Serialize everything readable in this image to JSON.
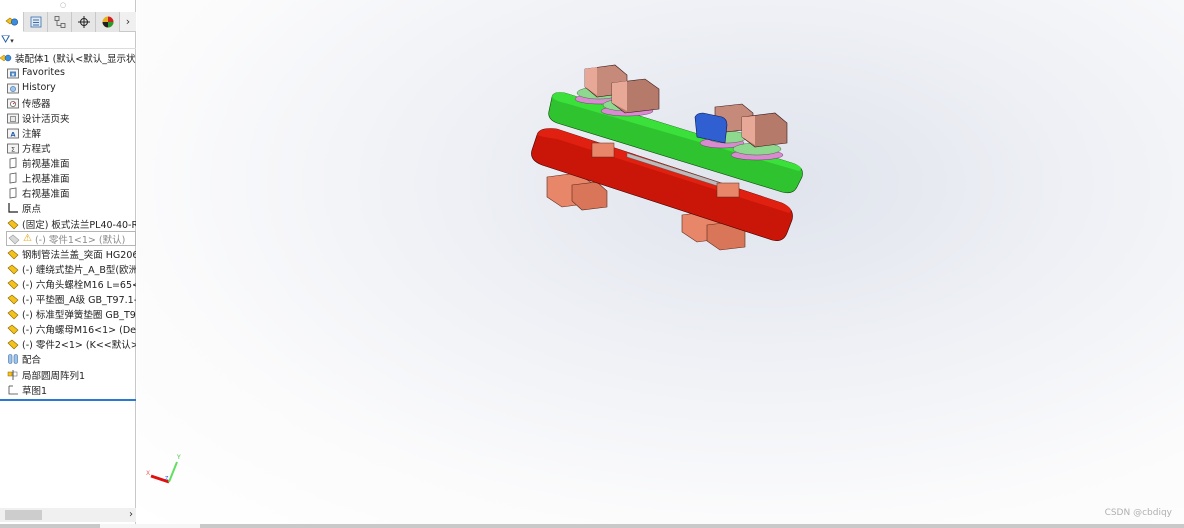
{
  "panel": {
    "tabs": [
      {
        "icon": "feature-manager-icon",
        "active": true
      },
      {
        "icon": "property-manager-icon",
        "active": false
      },
      {
        "icon": "configuration-manager-icon",
        "active": false
      },
      {
        "icon": "dimxpert-manager-icon",
        "active": false
      },
      {
        "icon": "display-manager-icon",
        "active": false
      }
    ],
    "tabs_more": "›",
    "filter": "▾",
    "tree": {
      "root": "装配体1  (默认<默认_显示状态",
      "items": [
        {
          "label": "Favorites",
          "icon": "favorites-folder-icon"
        },
        {
          "label": "History",
          "icon": "history-folder-icon"
        },
        {
          "label": "传感器",
          "icon": "sensors-folder-icon"
        },
        {
          "label": "设计活页夹",
          "icon": "design-binder-icon"
        },
        {
          "label": "注解",
          "icon": "annotations-icon"
        },
        {
          "label": "方程式",
          "icon": "equations-icon"
        },
        {
          "label": "前视基准面",
          "icon": "plane-icon"
        },
        {
          "label": "上视基准面",
          "icon": "plane-icon"
        },
        {
          "label": "右视基准面",
          "icon": "plane-icon"
        },
        {
          "label": "原点",
          "icon": "origin-icon"
        },
        {
          "label": "(固定) 板式法兰PL40-40-R",
          "icon": "part-icon"
        },
        {
          "label": "(-) 零件1<1> (默认)",
          "icon": "part-suppressed-icon",
          "suppressed": true,
          "warning": "⚠"
        },
        {
          "label": "钢制管法兰盖_突面 HG206",
          "icon": "part-icon"
        },
        {
          "label": "(-) 缠绕式垫片_A_B型(欧洲",
          "icon": "part-icon"
        },
        {
          "label": "(-) 六角头螺栓M16 L=65<",
          "icon": "part-icon"
        },
        {
          "label": "(-) 平垫圈_A级 GB_T97.1-",
          "icon": "part-icon"
        },
        {
          "label": "(-) 标准型弹簧垫圈 GB_T9",
          "icon": "part-icon"
        },
        {
          "label": "(-) 六角螺母M16<1> (Def",
          "icon": "part-icon"
        },
        {
          "label": "(-) 零件2<1> (K<<默认>_",
          "icon": "part-icon"
        },
        {
          "label": "配合",
          "icon": "mates-icon"
        },
        {
          "label": "局部圆周阵列1",
          "icon": "circular-pattern-icon"
        },
        {
          "label": "草图1",
          "icon": "sketch-icon"
        }
      ]
    },
    "hscroll_right": "›"
  },
  "viewport": {
    "triad": {
      "x": "X",
      "y": "Y",
      "z": "Z"
    },
    "colors": {
      "top_flange": "#2fd82f",
      "bottom_flange": "#d41a0a",
      "bolt": "#e8866a",
      "nut": "#c58a7a",
      "washer_green": "#8fd88f",
      "washer_pink": "#d98ad0",
      "block": "#2f5fd0"
    },
    "watermark": "CSDN @cbdiqy"
  }
}
